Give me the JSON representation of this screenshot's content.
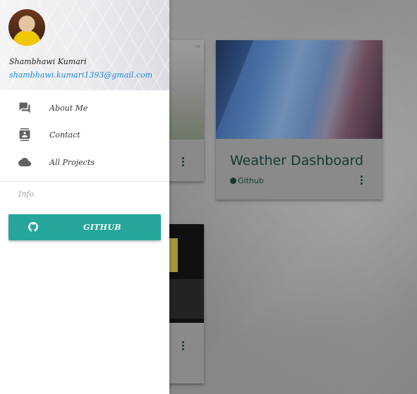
{
  "drawer": {
    "user": {
      "name": "Shambhawi Kumari",
      "email": "shambhawi.kumari1393@gmail.com"
    },
    "items": [
      {
        "label": "About Me",
        "icon": "forum-icon"
      },
      {
        "label": "Contact",
        "icon": "contact-card-icon"
      },
      {
        "label": "All Projects",
        "icon": "cloud-icon"
      }
    ],
    "subheader": "Info",
    "github_button": {
      "label": "GITHUB",
      "icon": "github-icon"
    }
  },
  "projects": {
    "weather_card": {
      "title": "Weather Dashboard",
      "link_label": "Github"
    }
  },
  "colors": {
    "accent": "#26a69a",
    "email_link": "#1e88e5",
    "card_text": "#123a33"
  }
}
